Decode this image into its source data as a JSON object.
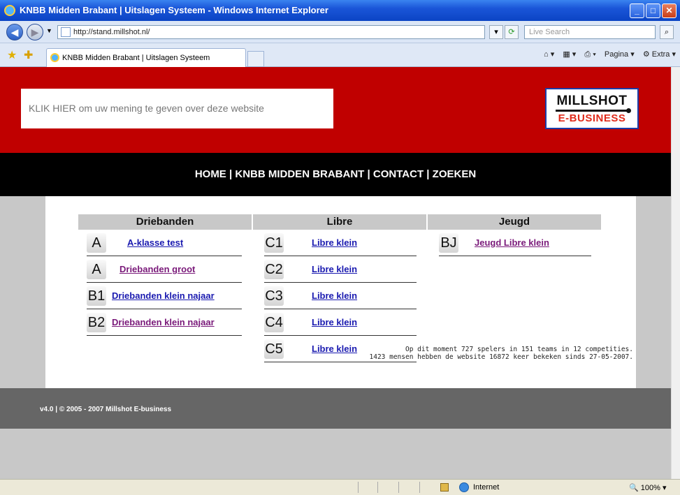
{
  "window": {
    "title": "KNBB Midden Brabant | Uitslagen Systeem - Windows Internet Explorer"
  },
  "address": {
    "url": "http://stand.millshot.nl/",
    "search_placeholder": "Live Search"
  },
  "tab": {
    "label": "KNBB Midden Brabant | Uitslagen Systeem"
  },
  "commandbar": {
    "page_label": "Pagina",
    "extra_label": "Extra"
  },
  "banner": {
    "opinion_text": "KLIK HIER om uw mening te geven over deze website",
    "logo_line1": "MILLSHOT",
    "logo_line2": "E-BUSINESS"
  },
  "nav": {
    "items": [
      "HOME",
      "KNBB MIDDEN BRABANT",
      "CONTACT",
      "ZOEKEN"
    ],
    "separator": " | "
  },
  "columns": [
    {
      "heading": "Driebanden",
      "rows": [
        {
          "code": "A",
          "label": "A-klasse test",
          "visited": false
        },
        {
          "code": "A",
          "label": "Driebanden groot",
          "visited": true
        },
        {
          "code": "B1",
          "label": "Driebanden klein najaar",
          "visited": false
        },
        {
          "code": "B2",
          "label": "Driebanden klein najaar",
          "visited": true
        }
      ]
    },
    {
      "heading": "Libre",
      "rows": [
        {
          "code": "C1",
          "label": "Libre klein",
          "visited": false
        },
        {
          "code": "C2",
          "label": "Libre klein",
          "visited": false
        },
        {
          "code": "C3",
          "label": "Libre klein",
          "visited": false
        },
        {
          "code": "C4",
          "label": "Libre klein",
          "visited": false
        },
        {
          "code": "C5",
          "label": "Libre klein",
          "visited": false
        }
      ]
    },
    {
      "heading": "Jeugd",
      "rows": [
        {
          "code": "BJ",
          "label": "Jeugd Libre klein",
          "visited": true
        }
      ]
    }
  ],
  "stats": {
    "line1": "Op dit moment 727 spelers in 151 teams in 12 competities.",
    "line2": "1423 mensen hebben de website 16872 keer bekeken sinds 27-05-2007."
  },
  "footer": {
    "text": "v4.0 | © 2005 - 2007 Millshot E-business"
  },
  "status": {
    "zone": "Internet",
    "zoom": "100%"
  },
  "colors": {
    "brand_red": "#c00000",
    "nav_black": "#000000",
    "link": "#1a1ab0",
    "visited": "#7a1a7a"
  }
}
